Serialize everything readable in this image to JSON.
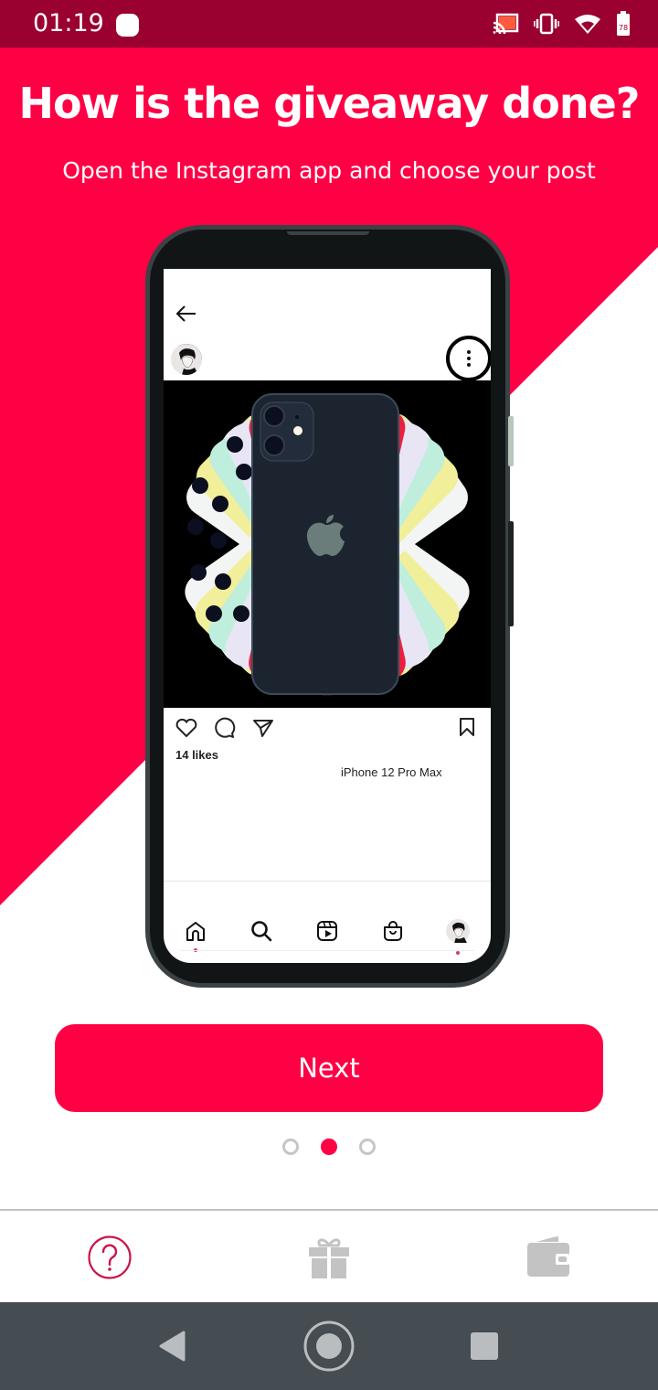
{
  "status_bar": {
    "time": "01:19",
    "battery_level": "78",
    "icons": [
      "notification-dot-icon",
      "cast-icon",
      "vibrate-icon",
      "wifi-icon",
      "battery-icon"
    ]
  },
  "header": {
    "title": "How is the giveaway done?",
    "subtitle": "Open the Instagram app and choose your post"
  },
  "mockup": {
    "post_likes": "14 likes",
    "post_caption": "iPhone 12 Pro Max",
    "post_image": "iphone-colors-fan-image",
    "nav_items": [
      "home-icon",
      "search-icon",
      "reels-icon",
      "shop-icon",
      "profile-avatar"
    ]
  },
  "next_button": {
    "label": "Next"
  },
  "pager": {
    "total": 3,
    "current_index": 1
  },
  "tabbar": {
    "items": [
      {
        "name": "help",
        "icon": "question-circle-icon",
        "active": true
      },
      {
        "name": "giveaway",
        "icon": "gift-icon",
        "active": false
      },
      {
        "name": "wallet",
        "icon": "wallet-icon",
        "active": false
      }
    ]
  },
  "system_nav": [
    "back-icon",
    "home-icon",
    "recents-icon"
  ],
  "colors": {
    "accent": "#ff0044",
    "status_bar": "#9a0030",
    "tab_active": "#c8174a",
    "tab_inactive": "#c3c3c3",
    "system_nav": "#454c52"
  }
}
